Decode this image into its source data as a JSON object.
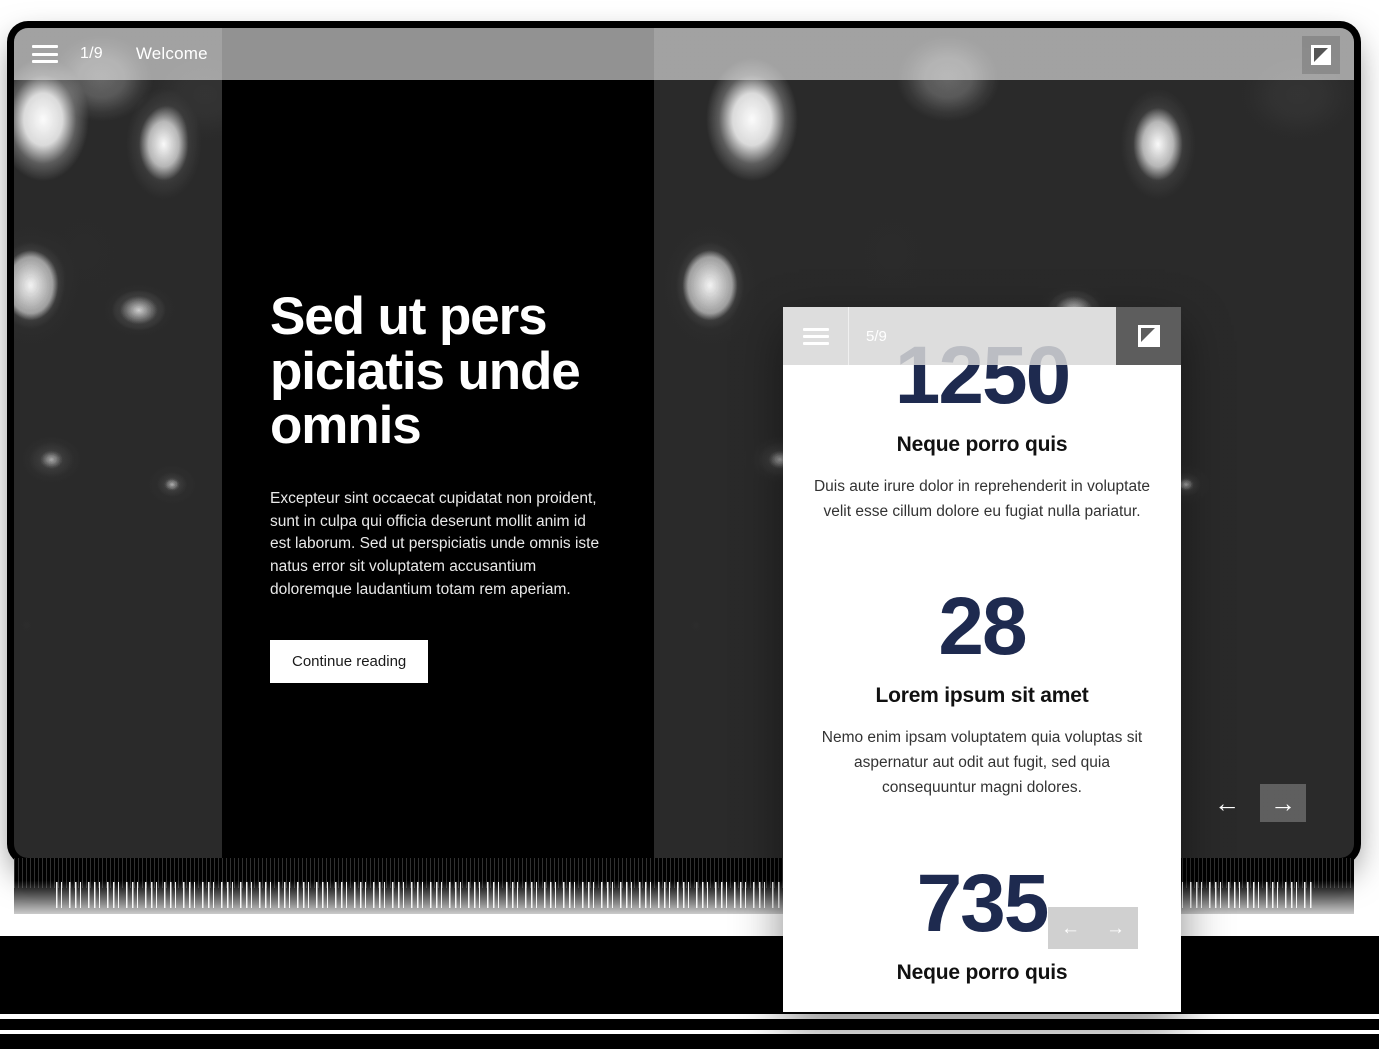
{
  "desktop": {
    "topbar": {
      "menu_icon": "hamburger-menu-icon",
      "counter": "1/9",
      "title": "Welcome",
      "expand_icon": "expand-fullscreen-icon"
    },
    "slide": {
      "heading": "Sed ut pers piciatis unde omnis",
      "body": "Excepteur sint occaecat cupidatat non proident, sunt in culpa qui officia deserunt mollit anim id est laborum. Sed ut perspiciatis unde omnis iste natus error sit voluptatem accusantium doloremque laudantium totam rem aperiam.",
      "cta_label": "Continue reading"
    },
    "nav": {
      "prev_icon": "arrow-left-icon",
      "next_icon": "arrow-right-icon",
      "prev_glyph": "←",
      "next_glyph": "→"
    }
  },
  "phone": {
    "topbar": {
      "menu_icon": "hamburger-menu-icon",
      "counter": "5/9",
      "expand_icon": "expand-fullscreen-icon"
    },
    "stats": [
      {
        "number": "1250",
        "heading": "Neque porro quis",
        "text": "Duis aute irure dolor in reprehenderit in voluptate velit esse cillum dolore eu fugiat nulla pariatur."
      },
      {
        "number": "28",
        "heading": "Lorem ipsum sit amet",
        "text": "Nemo enim ipsam voluptatem quia voluptas sit aspernatur aut odit aut fugit, sed quia consequuntur magni dolores."
      },
      {
        "number": "735",
        "heading": "Neque porro quis",
        "text": ""
      }
    ],
    "nav": {
      "prev_glyph": "←",
      "next_glyph": "→"
    }
  },
  "colors": {
    "accent_navy": "#1e2a4f",
    "panel_black": "#000000",
    "surface_white": "#ffffff",
    "topbar_gray": "#d7d7d7",
    "expand_button_gray": "#5d5d5d"
  }
}
